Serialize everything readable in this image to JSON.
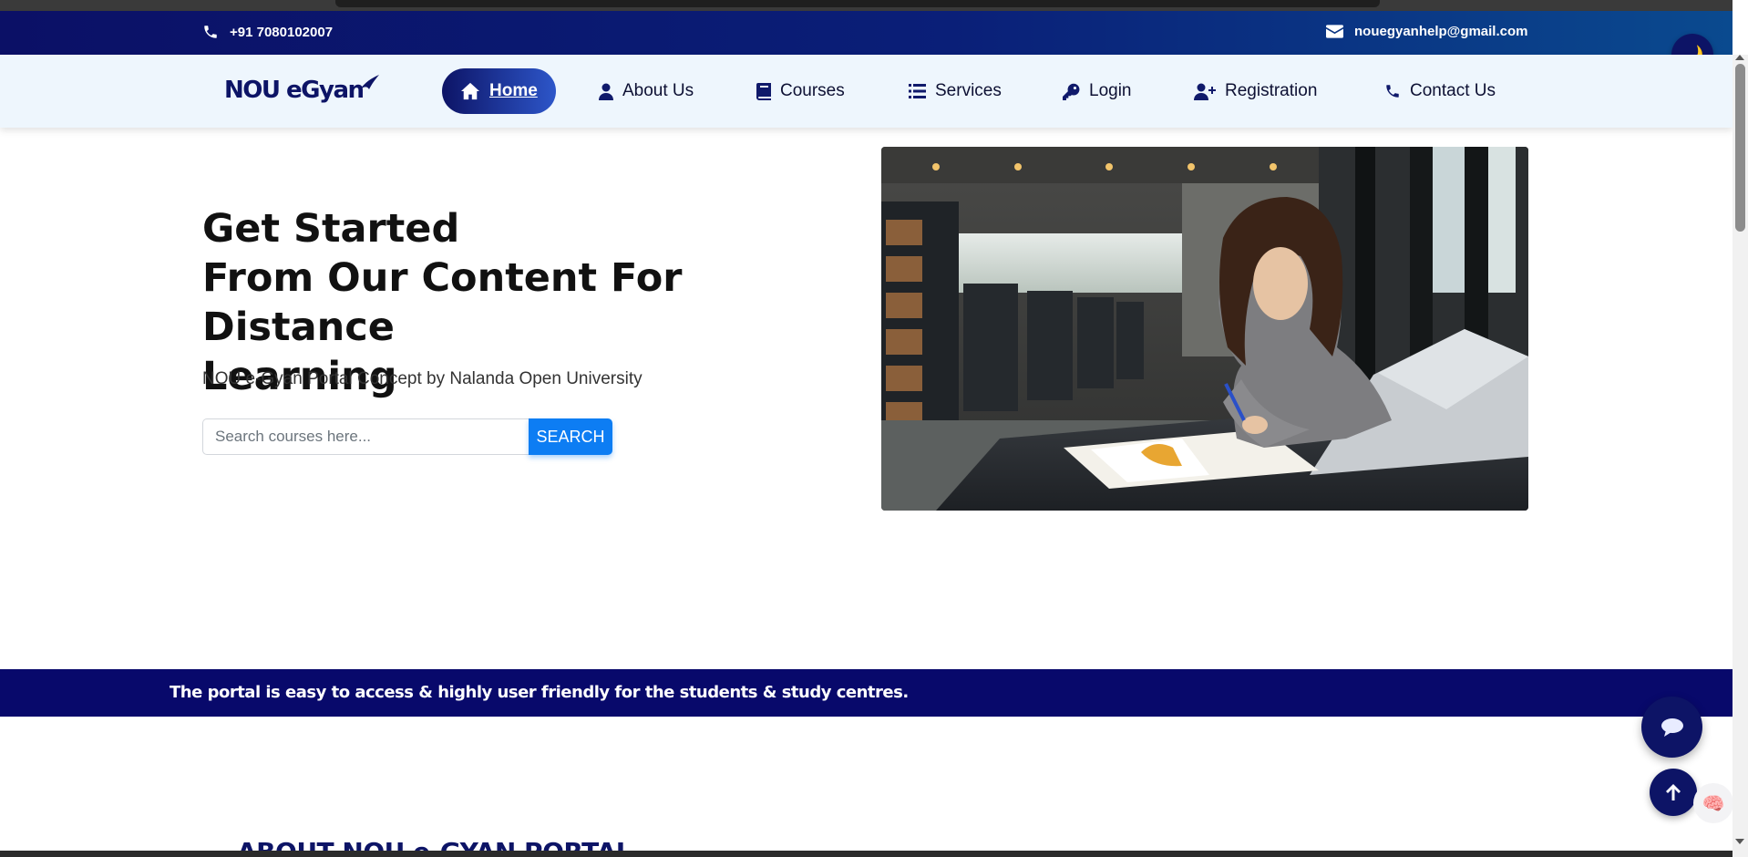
{
  "topbar": {
    "phone": "+91 7080102007",
    "email": "nouegyanhelp@gmail.com",
    "phone_icon": "phone-icon",
    "email_icon": "envelope-icon"
  },
  "logo": {
    "text": "NOU eGyan"
  },
  "nav": {
    "items": [
      {
        "label": "Home",
        "icon": "home-icon",
        "active": true
      },
      {
        "label": "About Us",
        "icon": "user-icon"
      },
      {
        "label": "Courses",
        "icon": "book-icon"
      },
      {
        "label": "Services",
        "icon": "list-icon"
      },
      {
        "label": "Login",
        "icon": "key-icon"
      },
      {
        "label": "Registration",
        "icon": "user-plus-icon"
      },
      {
        "label": "Contact Us",
        "icon": "phone-icon"
      }
    ]
  },
  "hero": {
    "title_line1": "Get Started",
    "title_line2": "From Our Content For Distance",
    "title_line3": "Learning",
    "subtitle": "NOU e-Gyan Portal Concept by Nalanda Open University",
    "search_placeholder": "Search courses here...",
    "search_button": "SEARCH"
  },
  "banner": {
    "text": "The portal is easy to access & highly user friendly for the students & study centres."
  },
  "about": {
    "heading": "ABOUT NOU e-GYAN PORTAL"
  },
  "colors": {
    "navy": "#0d1466",
    "accent_blue": "#0d7df3",
    "banner": "#08096b"
  }
}
